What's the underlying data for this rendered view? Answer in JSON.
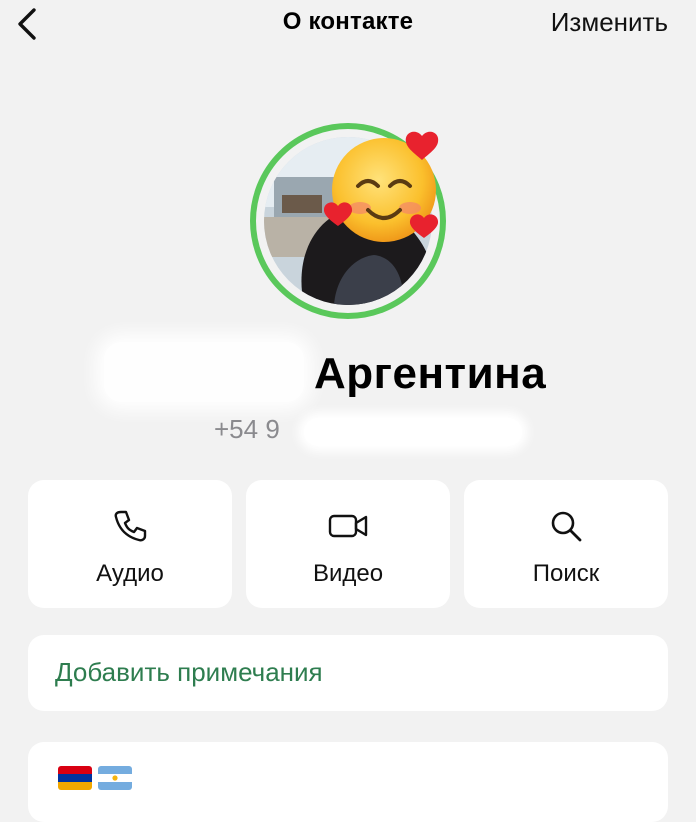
{
  "nav": {
    "title": "О контакте",
    "edit_label": "Изменить"
  },
  "contact": {
    "name_visible": "Аргентина",
    "phone_visible": "+54 9"
  },
  "actions": [
    {
      "label": "Аудио",
      "icon": "phone-icon"
    },
    {
      "label": "Видео",
      "icon": "video-camera-icon"
    },
    {
      "label": "Поиск",
      "icon": "search-icon"
    }
  ],
  "notes": {
    "label": "Добавить примечания"
  },
  "about": {
    "flags": [
      "armenia-flag",
      "argentina-flag"
    ]
  },
  "colors": {
    "ring": "#5ac85b",
    "notes_text": "#2e7d4f",
    "background": "#f2f2f2",
    "card": "#ffffff"
  }
}
